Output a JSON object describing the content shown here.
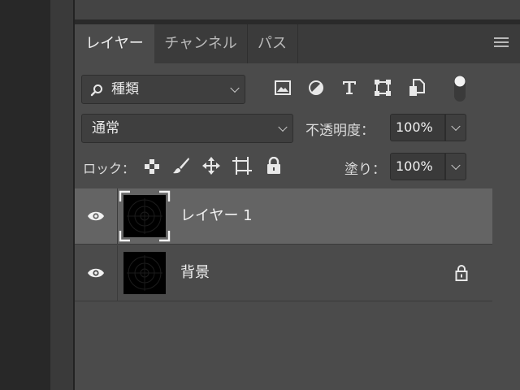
{
  "tabs": [
    {
      "label": "レイヤー",
      "active": true
    },
    {
      "label": "チャンネル",
      "active": false
    },
    {
      "label": "パス",
      "active": false
    }
  ],
  "filter": {
    "label": "種類",
    "icon": "search-icon"
  },
  "filter_icons": [
    "image-filter-icon",
    "adjustment-filter-icon",
    "type-filter-icon",
    "shape-filter-icon",
    "smart-object-filter-icon",
    "filter-toggle-icon"
  ],
  "blend_mode": "通常",
  "opacity": {
    "label": "不透明度：",
    "value": "100%"
  },
  "lock": {
    "label": "ロック：",
    "icons": [
      "lock-transparent-icon",
      "lock-paint-icon",
      "lock-position-icon",
      "lock-artboard-icon",
      "lock-all-icon"
    ]
  },
  "fill": {
    "label": "塗り：",
    "value": "100%"
  },
  "layers": [
    {
      "name": "レイヤー 1",
      "visible": true,
      "selected": true,
      "locked": false
    },
    {
      "name": "背景",
      "visible": true,
      "selected": false,
      "locked": true
    }
  ],
  "colors": {
    "panel": "#4b4b4b",
    "selected_row": "#646464",
    "tab_bar": "#3b3b3b"
  }
}
